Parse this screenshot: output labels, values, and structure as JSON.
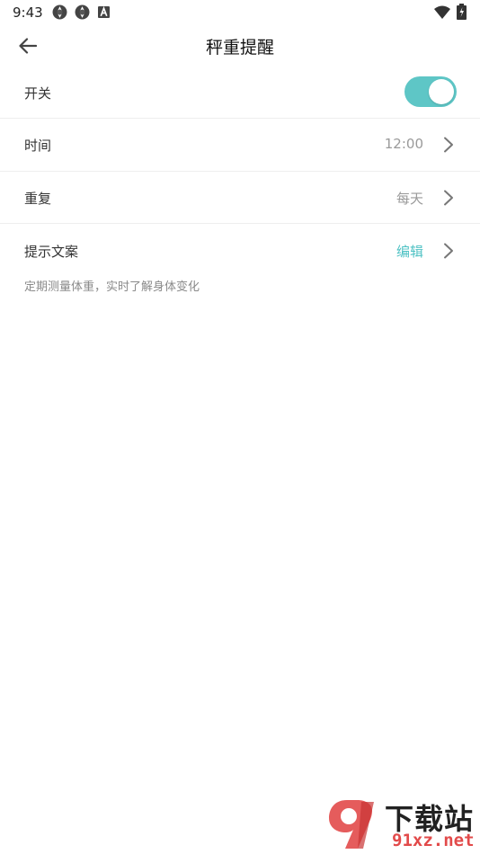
{
  "status_bar": {
    "time": "9:43"
  },
  "header": {
    "title": "秤重提醒"
  },
  "rows": {
    "switch": {
      "label": "开关",
      "enabled": true
    },
    "time": {
      "label": "时间",
      "value": "12:00"
    },
    "repeat": {
      "label": "重复",
      "value": "每天"
    },
    "prompt": {
      "label": "提示文案",
      "action": "编辑",
      "hint": "定期测量体重，实时了解身体变化"
    }
  },
  "watermark": {
    "text_cn": "下载站",
    "text_en": "91xz.net"
  },
  "colors": {
    "accent": "#4fc2c4",
    "toggle_on": "#5ec6c6",
    "watermark_red": "#e24a4a"
  },
  "icons": [
    "app-icon",
    "app-icon",
    "a-icon",
    "wifi-icon",
    "battery-icon",
    "back-arrow-icon",
    "chevron-right-icon"
  ]
}
